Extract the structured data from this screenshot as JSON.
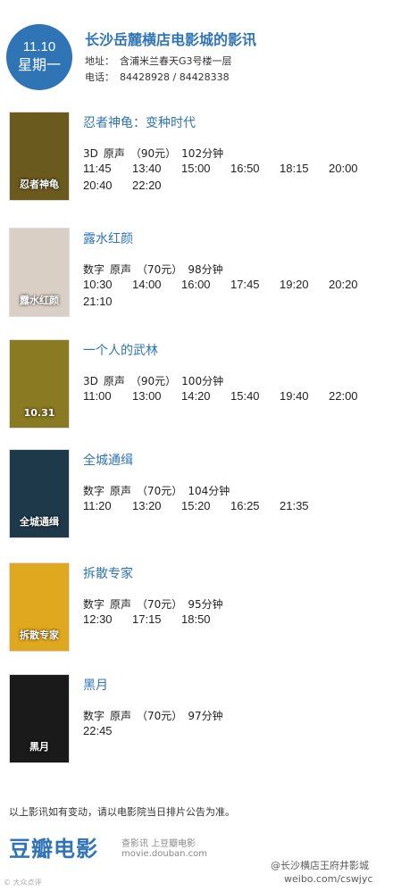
{
  "header": {
    "date": "11.10",
    "weekday": "星期一",
    "cinema_name": "长沙岳麓横店电影城的影讯",
    "address_label": "地址：",
    "address": "含浦米兰春天G3号楼一层",
    "phone_label": "电话：",
    "phone": "84428928 / 84428338"
  },
  "movies": [
    {
      "title": "忍者神龟：变种时代",
      "format": "3D",
      "audio": "原声",
      "price": "（90元）",
      "duration": "102分钟",
      "times": [
        "11:45",
        "13:40",
        "15:00",
        "16:50",
        "18:15",
        "20:00",
        "20:40",
        "22:20"
      ],
      "poster_color": "#6b5a1e",
      "poster_text": "忍者神龟"
    },
    {
      "title": "露水红颜",
      "format": "数字",
      "audio": "原声",
      "price": "（70元）",
      "duration": "98分钟",
      "times": [
        "10:30",
        "14:00",
        "16:00",
        "17:45",
        "19:20",
        "20:20",
        "21:10"
      ],
      "poster_color": "#d9cfc4",
      "poster_text": "露水红颜"
    },
    {
      "title": "一个人的武林",
      "format": "3D",
      "audio": "原声",
      "price": "（90元）",
      "duration": "100分钟",
      "times": [
        "11:00",
        "13:00",
        "14:20",
        "15:40",
        "19:40",
        "22:00"
      ],
      "poster_color": "#8a7a22",
      "poster_text": "10.31"
    },
    {
      "title": "全城通缉",
      "format": "数字",
      "audio": "原声",
      "price": "（70元）",
      "duration": "104分钟",
      "times": [
        "11:20",
        "13:20",
        "15:20",
        "16:25",
        "21:35"
      ],
      "poster_color": "#1e3a4a",
      "poster_text": "全城通缉"
    },
    {
      "title": "拆散专家",
      "format": "数字",
      "audio": "原声",
      "price": "（70元）",
      "duration": "95分钟",
      "times": [
        "12:30",
        "17:15",
        "18:50"
      ],
      "poster_color": "#e0a81e",
      "poster_text": "拆散专家"
    },
    {
      "title": "黑月",
      "format": "数字",
      "audio": "原声",
      "price": "（70元）",
      "duration": "97分钟",
      "times": [
        "22:45"
      ],
      "poster_color": "#1a1a1a",
      "poster_text": "黑月"
    }
  ],
  "footer": {
    "note": "以上影讯如有变动，请以电影院当日排片公告为准。",
    "brand": "豆瓣电影",
    "links": "查影讯   上豆瓣电影",
    "url": "movie.douban.com",
    "watermark": "@长沙横店王府井影城",
    "watermark_url": "weibo.com/cswjyc",
    "corner_tag": "© 大众点评"
  },
  "colors": {
    "accent": "#2f74b5"
  }
}
